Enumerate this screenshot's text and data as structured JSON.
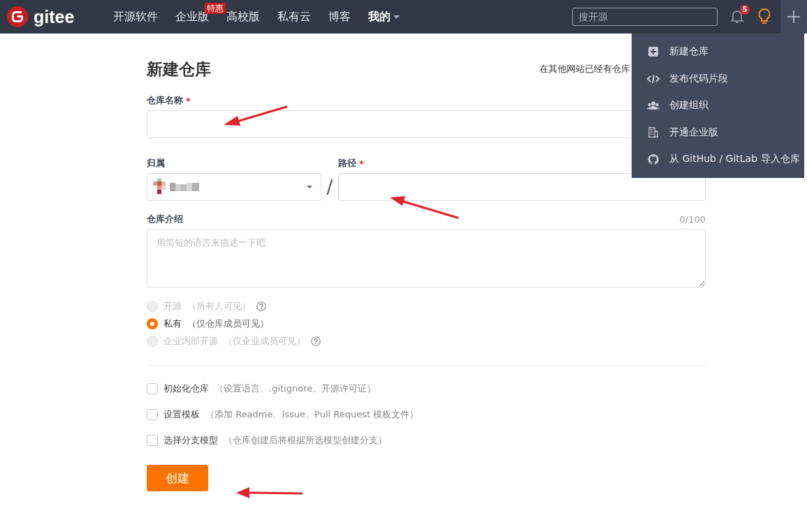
{
  "navbar": {
    "logo": "gitee",
    "items": [
      {
        "label": "开源软件",
        "dropdown": false
      },
      {
        "label": "企业版",
        "badge": "特惠",
        "dropdown": false
      },
      {
        "label": "高校版",
        "dropdown": false
      },
      {
        "label": "私有云",
        "dropdown": false
      },
      {
        "label": "博客",
        "dropdown": false
      },
      {
        "label": "我的",
        "dropdown": true
      }
    ],
    "search": {
      "placeholder": "搜开源"
    },
    "notifications": "5",
    "plus_menu": {
      "expanded": true,
      "items": [
        {
          "kind": "new",
          "label": "新建仓库"
        },
        {
          "kind": "code",
          "label": "发布代码片段"
        },
        {
          "kind": "group",
          "label": "创建组织"
        },
        {
          "kind": "building",
          "label": "开通企业版"
        },
        {
          "kind": "github",
          "label": "从 GitHub / GitLab 导入仓库"
        }
      ]
    }
  },
  "form": {
    "title": "新建仓库",
    "import_hint": "在其他网站已经有仓库",
    "name": {
      "label": "仓库名称",
      "mark": "*"
    },
    "owner": {
      "label": "归属"
    },
    "separator": "/",
    "path": {
      "label": "路径",
      "mark": "*"
    },
    "description": {
      "label": "仓库介绍",
      "counter": "0/100",
      "placeholder": "用简短的语言来描述一下吧"
    },
    "visibility": [
      {
        "label": "开源",
        "note": "（所有人可见）",
        "selected": false,
        "disabled": true,
        "help": true
      },
      {
        "label": "私有",
        "note": "（仅仓库成员可见）",
        "selected": true,
        "disabled": false,
        "help": false
      },
      {
        "label": "企业内部开源",
        "note": "（仅企业成员可见）",
        "selected": false,
        "disabled": true,
        "help": true
      }
    ],
    "options": [
      {
        "label": "初始化仓库",
        "note": "（设置语言、.gitignore、开源许可证）",
        "checked": false
      },
      {
        "label": "设置模板",
        "note": "（添加 Readme、Issue、Pull Request 模板文件）",
        "checked": false
      },
      {
        "label": "选择分支模型",
        "note": "（仓库创建后将根据所选模型创建分支）",
        "checked": false
      }
    ],
    "submit": "创建"
  }
}
